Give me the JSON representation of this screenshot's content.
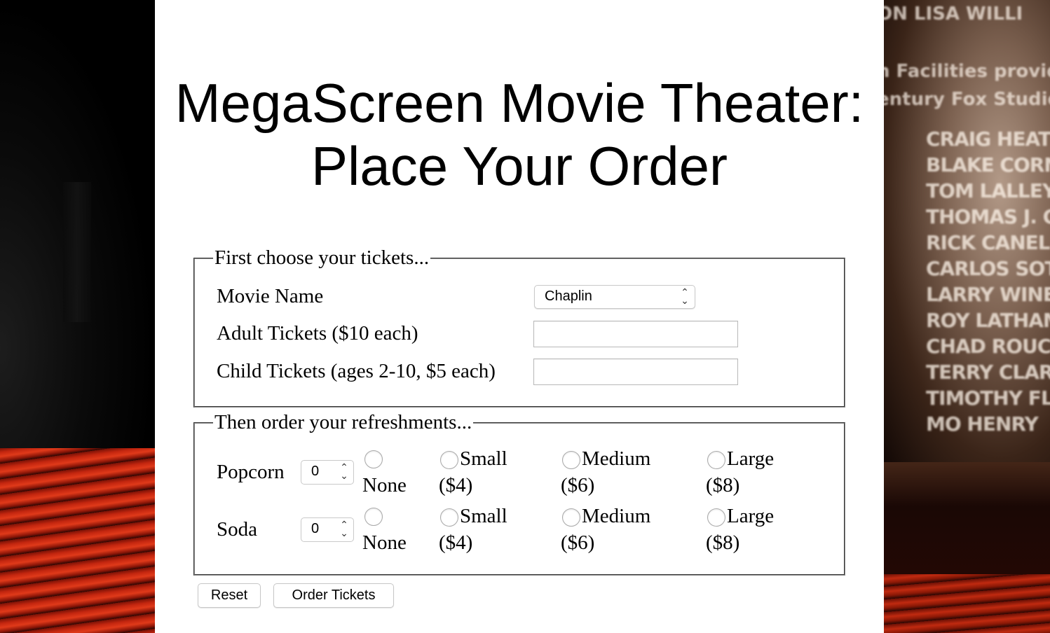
{
  "page": {
    "title": "MegaScreen Movie Theater: Place Your Order"
  },
  "tickets": {
    "legend": "First choose your tickets...",
    "movie_label": "Movie Name",
    "movie_selected": "Chaplin",
    "adult_label": "Adult Tickets ($10 each)",
    "adult_value": "",
    "child_label": "Child Tickets (ages 2-10, $5 each)",
    "child_value": ""
  },
  "refreshments": {
    "legend": "Then order your refreshments...",
    "items": [
      {
        "label": "Popcorn",
        "quantity": "0",
        "sizes": [
          {
            "line1": "",
            "line2": "None"
          },
          {
            "line1": "Small",
            "line2": "($4)"
          },
          {
            "line1": "Medium",
            "line2": "($6)"
          },
          {
            "line1": "Large",
            "line2": "($8)"
          }
        ]
      },
      {
        "label": "Soda",
        "quantity": "0",
        "sizes": [
          {
            "line1": "",
            "line2": "None"
          },
          {
            "line1": "Small",
            "line2": "($4)"
          },
          {
            "line1": "Medium",
            "line2": "($6)"
          },
          {
            "line1": "Large",
            "line2": "($8)"
          }
        ]
      }
    ]
  },
  "buttons": {
    "reset": "Reset",
    "order": "Order Tickets"
  },
  "background": {
    "credits_top": [
      "ON   LISA WILLI",
      "n Facilities provide",
      "entury Fox Studio"
    ],
    "credits": [
      "CRAIG HEATH",
      "BLAKE CORN",
      "TOM LALLEY",
      "THOMAS J. G",
      "RICK CANELL",
      "CARLOS SOTO",
      "LARRY WINE",
      "ROY LATHAM",
      "CHAD ROUCH",
      "TERRY CLARK",
      "TIMOTHY FLE",
      "MO HENRY"
    ]
  }
}
